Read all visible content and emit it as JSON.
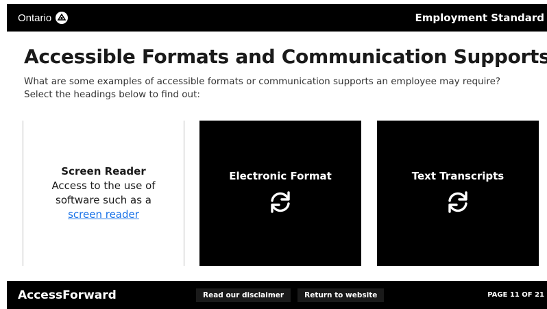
{
  "header": {
    "brand_text": "Ontario",
    "course_title": "Employment Standard"
  },
  "main": {
    "title": "Accessible Formats and Communication Supports",
    "intro_line1": "What are some examples of accessible formats or communication supports an employee may require?",
    "intro_line2": "Select the headings below to find out:"
  },
  "cards": [
    {
      "heading": "Screen Reader",
      "body_prefix": "Access to the use of software such as a",
      "link_text": "screen reader",
      "state": "revealed"
    },
    {
      "heading": "Electronic Format",
      "icon": "flip-icon",
      "state": "front"
    },
    {
      "heading": "Text Transcripts",
      "icon": "flip-icon",
      "state": "front"
    }
  ],
  "footer": {
    "brand_text": "AccessForward",
    "disclaimer_label": "Read our disclaimer",
    "return_label": "Return to website",
    "page_counter": "PAGE 11 OF 21"
  },
  "colors": {
    "bar_background": "#000000",
    "link": "#1a73e8"
  }
}
